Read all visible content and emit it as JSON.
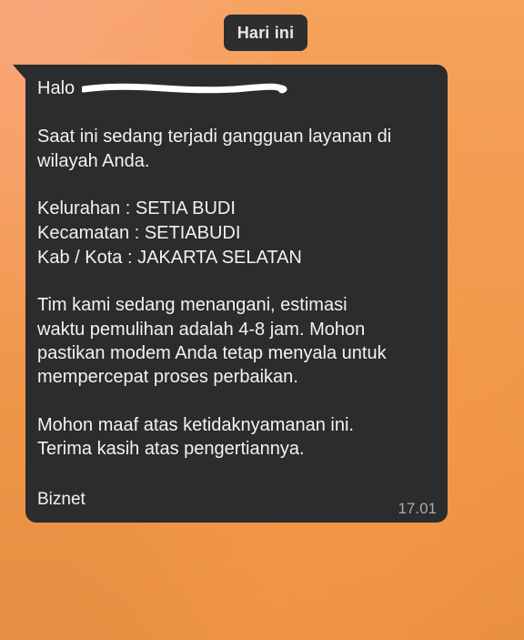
{
  "date_chip": "Hari ini",
  "message": {
    "greeting": "Halo",
    "line_1": "Saat ini sedang terjadi gangguan layanan di",
    "line_2": "wilayah Anda.",
    "kelurahan": "Kelurahan : SETIA BUDI",
    "kecamatan": "Kecamatan : SETIABUDI",
    "kota": "Kab / Kota : JAKARTA SELATAN",
    "line_3": "Tim kami sedang menangani, estimasi",
    "line_4": "waktu pemulihan adalah 4-8 jam. Mohon",
    "line_5": "pastikan modem Anda tetap menyala untuk",
    "line_6": "mempercepat proses perbaikan.",
    "line_7": "Mohon maaf atas ketidaknyamanan ini.",
    "line_8": "Terima kasih atas pengertiannya.",
    "sender": "Biznet",
    "time": "17.01"
  },
  "colors": {
    "bubble": "#2a2c2e",
    "chip": "#2c2e30",
    "redaction": "#ffffff",
    "background": "#f29a4f"
  }
}
